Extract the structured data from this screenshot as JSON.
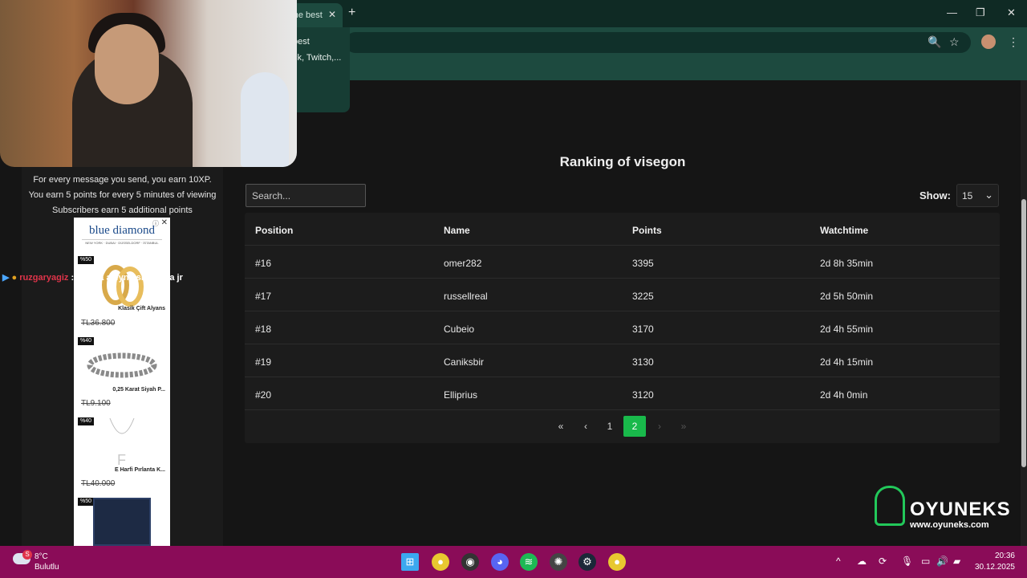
{
  "browser": {
    "tab_title": "The best",
    "tab_close": "✕",
    "new_tab": "+",
    "popup_line1": "best",
    "popup_line2": "ck, Twitch,..."
  },
  "stream": {
    "info_lines": [
      "For every message you send, you earn 10XP.",
      "You earn 5 points for every 5 minutes of viewing",
      "Subscribers earn 5 additional points"
    ],
    "chat": {
      "user": "ruzgaryagiz",
      "message": ": aleyna aleyna sr aleyna jr"
    }
  },
  "ad": {
    "brand": "blue diamond",
    "cities": "NEW YORK · DUBAI · DÜSSELDORF · İSTANBUL",
    "products": [
      {
        "badge": "%50",
        "name": "Klasik Çift Alyans",
        "price": "TL36.800"
      },
      {
        "badge": "%40",
        "name": "0,25 Karat Siyah P...",
        "price": "TL9.100"
      },
      {
        "badge": "%40",
        "name": "E Harfi Pırlanta K...",
        "price": "TL40.000"
      },
      {
        "badge": "%50"
      }
    ]
  },
  "ranking": {
    "title": "Ranking of visegon",
    "search_placeholder": "Search...",
    "show_label": "Show:",
    "show_value": "15",
    "columns": [
      "Position",
      "Name",
      "Points",
      "Watchtime"
    ],
    "rows": [
      {
        "position": "#16",
        "name": "omer282",
        "points": "3395",
        "watchtime": "2d 8h 35min"
      },
      {
        "position": "#17",
        "name": "russellreal",
        "points": "3225",
        "watchtime": "2d 5h 50min"
      },
      {
        "position": "#18",
        "name": "Cubeio",
        "points": "3170",
        "watchtime": "2d 4h 55min"
      },
      {
        "position": "#19",
        "name": "Caniksbir",
        "points": "3130",
        "watchtime": "2d 4h 15min"
      },
      {
        "position": "#20",
        "name": "Elliprius",
        "points": "3120",
        "watchtime": "2d 4h 0min"
      }
    ],
    "pagination": {
      "first": "«",
      "prev": "‹",
      "pages": [
        "1",
        "2"
      ],
      "current": "2",
      "next": "›",
      "last": "»"
    }
  },
  "brand": {
    "name": "OYUNEKS",
    "url": "www.oyuneks.com"
  },
  "taskbar": {
    "weather_badge": "S",
    "temp": "8°C",
    "condition": "Bulutlu",
    "time": "20:36",
    "date": "30.12.2025"
  },
  "colors": {
    "accent": "#19b94b",
    "taskbar": "#8a0c58",
    "browser": "#1d4a3f"
  }
}
